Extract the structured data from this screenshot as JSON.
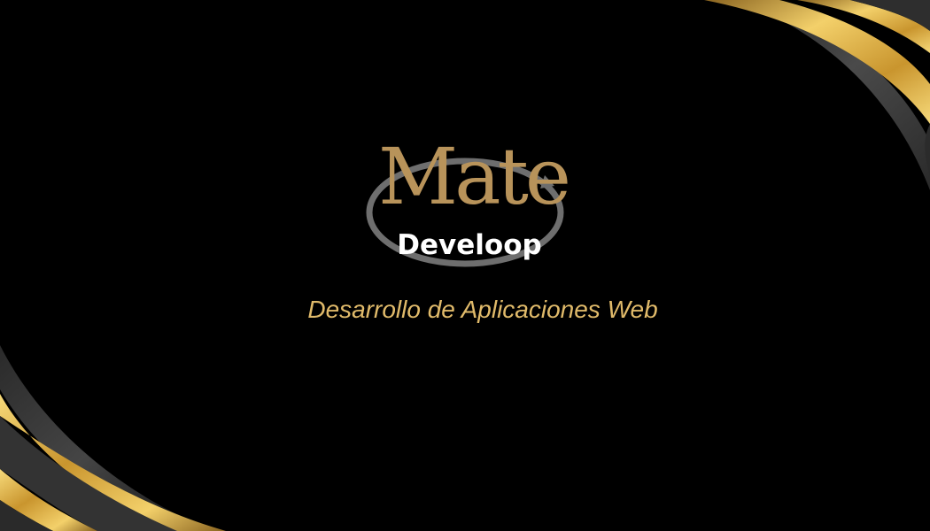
{
  "logo": {
    "primary_word": "Mate",
    "secondary_word": "Develoop"
  },
  "tagline": "Desarrollo de Aplicaciones Web",
  "colors": {
    "background": "#000000",
    "gold": "#e0b64f",
    "logo_gold": "#b8935a",
    "ring_gray": "#6e6e6e",
    "tagline": "#e0ba6a",
    "swoosh_dark": "#3a3a3a"
  }
}
